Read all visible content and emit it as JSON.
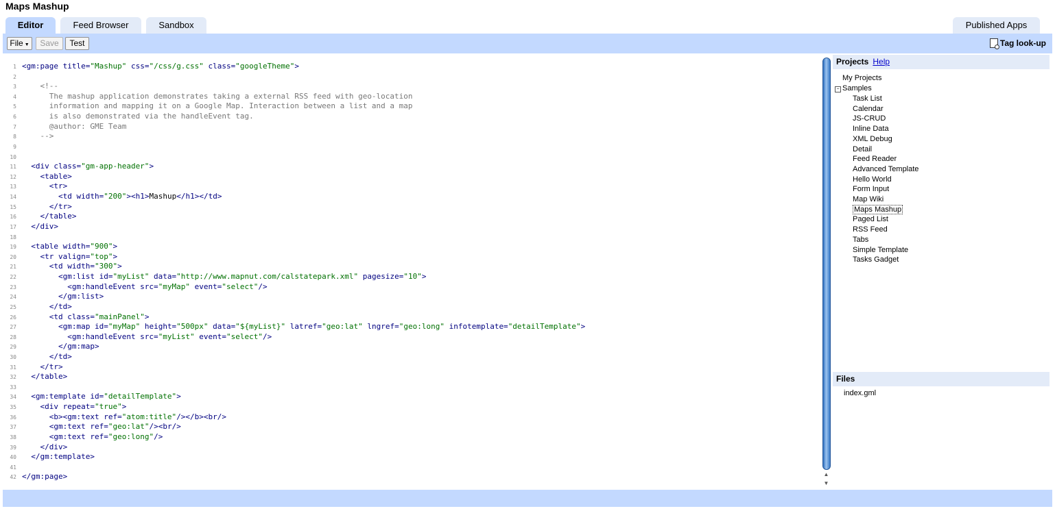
{
  "app": {
    "title": "Maps Mashup"
  },
  "tabs": [
    {
      "label": "Editor",
      "active": true
    },
    {
      "label": "Feed Browser",
      "active": false
    },
    {
      "label": "Sandbox",
      "active": false
    }
  ],
  "published_tab": {
    "label": "Published Apps"
  },
  "toolbar": {
    "file_label": "File",
    "save_label": "Save",
    "test_label": "Test",
    "tag_lookup_label": "Tag look-up"
  },
  "projects": {
    "title": "Projects",
    "help_label": "Help",
    "my_projects": "My Projects",
    "samples_label": "Samples",
    "samples": [
      "Task List",
      "Calendar",
      "JS-CRUD",
      "Inline Data",
      "XML Debug",
      "Detail",
      "Feed Reader",
      "Advanced Template",
      "Hello World",
      "Form Input",
      "Map Wiki",
      "Maps Mashup",
      "Paged List",
      "RSS Feed",
      "Tabs",
      "Simple Template",
      "Tasks Gadget"
    ],
    "selected": "Maps Mashup"
  },
  "files": {
    "title": "Files",
    "items": [
      "index.gml"
    ]
  },
  "colors": {
    "toolbar": "#c3d9ff",
    "tab_inactive": "#e3ebf8",
    "tag": "#000080",
    "string": "#007000",
    "comment": "#777777"
  },
  "code": {
    "lines": [
      [
        [
          "t",
          "<gm:page title="
        ],
        [
          "s",
          "\"Mashup\""
        ],
        [
          "t",
          " css="
        ],
        [
          "s",
          "\"/css/g.css\""
        ],
        [
          "t",
          " class="
        ],
        [
          "s",
          "\"googleTheme\""
        ],
        [
          "t",
          ">"
        ]
      ],
      [],
      [
        [
          "c",
          "    <!--"
        ]
      ],
      [
        [
          "c",
          "      The mashup application demonstrates taking a external RSS feed with geo-location"
        ]
      ],
      [
        [
          "c",
          "      information and mapping it on a Google Map. Interaction between a list and a map"
        ]
      ],
      [
        [
          "c",
          "      is also demonstrated via the handleEvent tag."
        ]
      ],
      [
        [
          "c",
          "      @author: GME Team"
        ]
      ],
      [
        [
          "c",
          "    -->"
        ]
      ],
      [],
      [],
      [
        [
          "t",
          "  <div class="
        ],
        [
          "s",
          "\"gm-app-header\""
        ],
        [
          "t",
          ">"
        ]
      ],
      [
        [
          "t",
          "    <table>"
        ]
      ],
      [
        [
          "t",
          "      <tr>"
        ]
      ],
      [
        [
          "t",
          "        <td width="
        ],
        [
          "s",
          "\"200\""
        ],
        [
          "t",
          "><h1>"
        ],
        [
          "x",
          "Mashup"
        ],
        [
          "t",
          "</h1></td>"
        ]
      ],
      [
        [
          "t",
          "      </tr>"
        ]
      ],
      [
        [
          "t",
          "    </table>"
        ]
      ],
      [
        [
          "t",
          "  </div>"
        ]
      ],
      [],
      [
        [
          "t",
          "  <table width="
        ],
        [
          "s",
          "\"900\""
        ],
        [
          "t",
          ">"
        ]
      ],
      [
        [
          "t",
          "    <tr valign="
        ],
        [
          "s",
          "\"top\""
        ],
        [
          "t",
          ">"
        ]
      ],
      [
        [
          "t",
          "      <td width="
        ],
        [
          "s",
          "\"300\""
        ],
        [
          "t",
          ">"
        ]
      ],
      [
        [
          "t",
          "        <gm:list id="
        ],
        [
          "s",
          "\"myList\""
        ],
        [
          "t",
          " data="
        ],
        [
          "s",
          "\"http://www.mapnut.com/calstatepark.xml\""
        ],
        [
          "t",
          " pagesize="
        ],
        [
          "s",
          "\"10\""
        ],
        [
          "t",
          ">"
        ]
      ],
      [
        [
          "t",
          "          <gm:handleEvent src="
        ],
        [
          "s",
          "\"myMap\""
        ],
        [
          "t",
          " event="
        ],
        [
          "s",
          "\"select\""
        ],
        [
          "t",
          "/>"
        ]
      ],
      [
        [
          "t",
          "        </gm:list>"
        ]
      ],
      [
        [
          "t",
          "      </td>"
        ]
      ],
      [
        [
          "t",
          "      <td class="
        ],
        [
          "s",
          "\"mainPanel\""
        ],
        [
          "t",
          ">"
        ]
      ],
      [
        [
          "t",
          "        <gm:map id="
        ],
        [
          "s",
          "\"myMap\""
        ],
        [
          "t",
          " height="
        ],
        [
          "s",
          "\"500px\""
        ],
        [
          "t",
          " data="
        ],
        [
          "s",
          "\"${myList}\""
        ],
        [
          "t",
          " latref="
        ],
        [
          "s",
          "\"geo:lat\""
        ],
        [
          "t",
          " lngref="
        ],
        [
          "s",
          "\"geo:long\""
        ],
        [
          "t",
          " infotemplate="
        ],
        [
          "s",
          "\"detailTemplate\""
        ],
        [
          "t",
          ">"
        ]
      ],
      [
        [
          "t",
          "          <gm:handleEvent src="
        ],
        [
          "s",
          "\"myList\""
        ],
        [
          "t",
          " event="
        ],
        [
          "s",
          "\"select\""
        ],
        [
          "t",
          "/>"
        ]
      ],
      [
        [
          "t",
          "        </gm:map>"
        ]
      ],
      [
        [
          "t",
          "      </td>"
        ]
      ],
      [
        [
          "t",
          "    </tr>"
        ]
      ],
      [
        [
          "t",
          "  </table>"
        ]
      ],
      [],
      [
        [
          "t",
          "  <gm:template id="
        ],
        [
          "s",
          "\"detailTemplate\""
        ],
        [
          "t",
          ">"
        ]
      ],
      [
        [
          "t",
          "    <div repeat="
        ],
        [
          "s",
          "\"true\""
        ],
        [
          "t",
          ">"
        ]
      ],
      [
        [
          "t",
          "      <b><gm:text ref="
        ],
        [
          "s",
          "\"atom:title\""
        ],
        [
          "t",
          "/></b><br/>"
        ]
      ],
      [
        [
          "t",
          "      <gm:text ref="
        ],
        [
          "s",
          "\"geo:lat\""
        ],
        [
          "t",
          "/><br/>"
        ]
      ],
      [
        [
          "t",
          "      <gm:text ref="
        ],
        [
          "s",
          "\"geo:long\""
        ],
        [
          "t",
          "/>"
        ]
      ],
      [
        [
          "t",
          "    </div>"
        ]
      ],
      [
        [
          "t",
          "  </gm:template>"
        ]
      ],
      [],
      [
        [
          "t",
          "</gm:page>"
        ]
      ]
    ]
  }
}
